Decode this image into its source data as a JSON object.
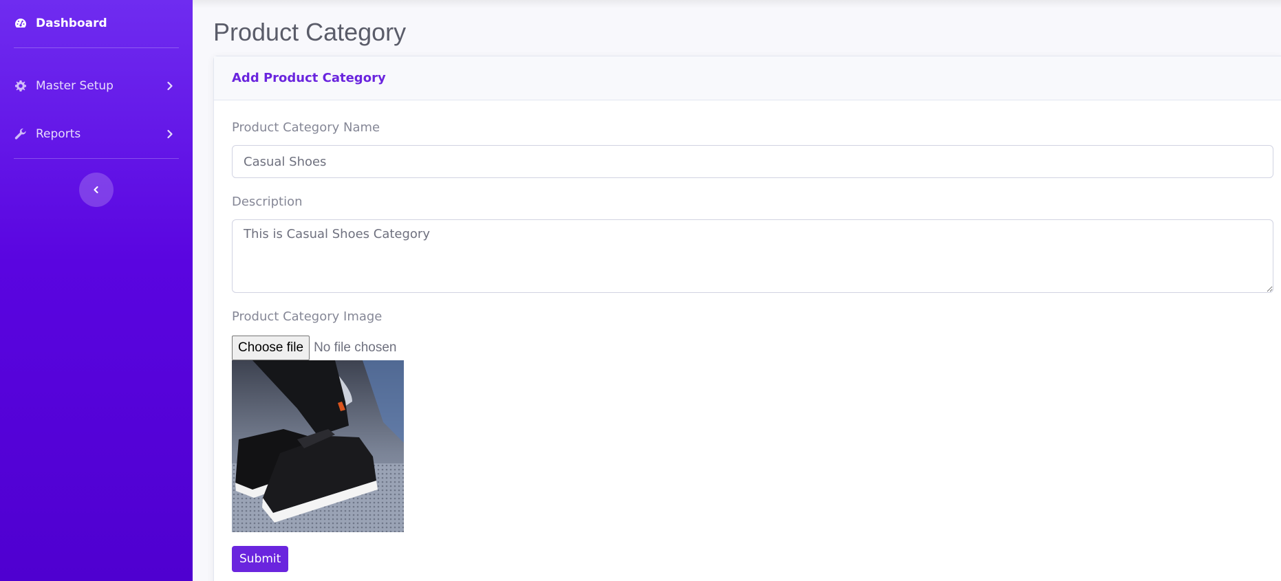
{
  "sidebar": {
    "brand": {
      "label": "Dashboard",
      "icon": "tachometer-icon"
    },
    "items": [
      {
        "label": "Master Setup",
        "icon": "gear-icon",
        "chevron": "chevron-right-icon"
      },
      {
        "label": "Reports",
        "icon": "wrench-icon",
        "chevron": "chevron-right-icon"
      }
    ],
    "toggle_icon": "chevron-left-icon"
  },
  "page": {
    "title": "Product Category"
  },
  "form": {
    "header": "Add Product Category",
    "name_label": "Product Category Name",
    "name_value": "Casual Shoes",
    "description_label": "Description",
    "description_value": "This is Casual Shoes Category",
    "image_label": "Product Category Image",
    "file_button_label": "Choose file",
    "file_status": "No file chosen",
    "submit_label": "Submit"
  },
  "colors": {
    "accent": "#6a25de",
    "sidebar_top": "#6f2cf0",
    "sidebar_bottom": "#4f00d0"
  }
}
